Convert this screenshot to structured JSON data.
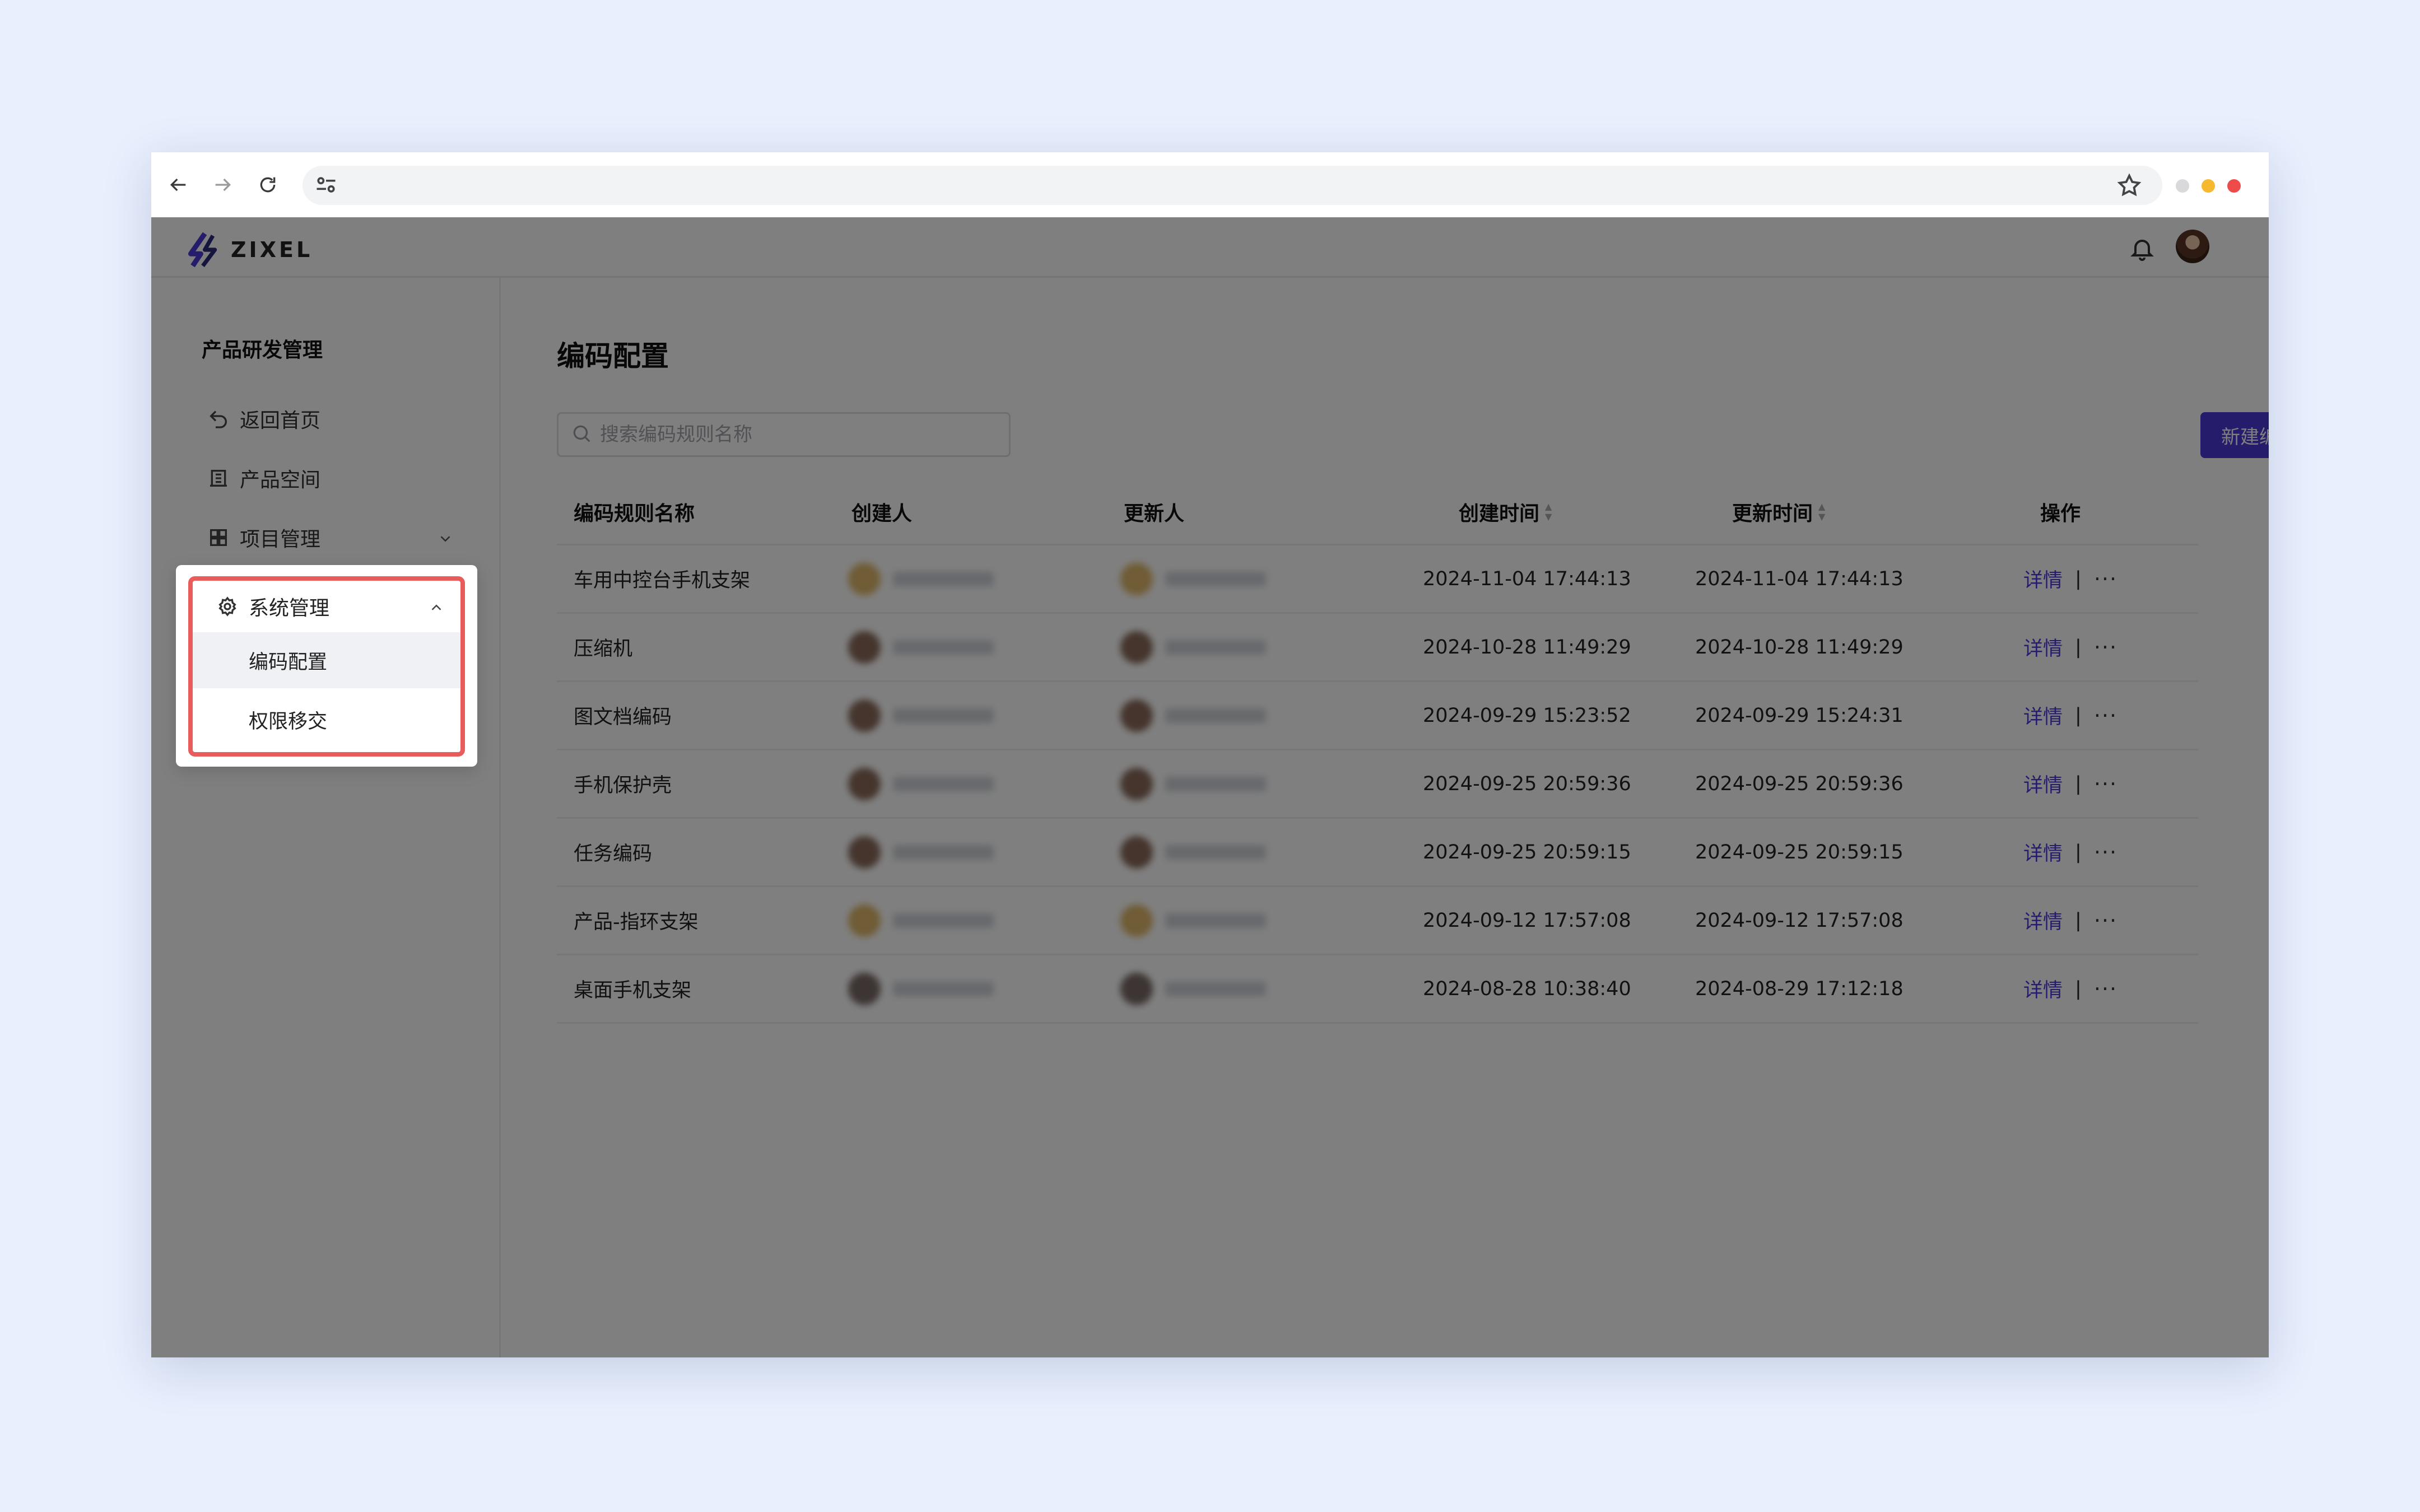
{
  "browser": {
    "url": ""
  },
  "app": {
    "brand": "ZIXEL"
  },
  "sidebar": {
    "title": "产品研发管理",
    "items": [
      {
        "label": "返回首页"
      },
      {
        "label": "产品空间"
      },
      {
        "label": "项目管理"
      },
      {
        "label": "系统管理"
      }
    ],
    "submenu": [
      {
        "label": "编码配置"
      },
      {
        "label": "权限移交"
      }
    ]
  },
  "main": {
    "title": "编码配置",
    "search_placeholder": "搜索编码规则名称",
    "new_button": "新建编码规则",
    "columns": [
      "编码规则名称",
      "创建人",
      "更新人",
      "创建时间",
      "更新时间",
      "操作"
    ],
    "rows": [
      {
        "name": "车用中控台手机支架",
        "created": "2024-11-04 17:44:13",
        "updated": "2024-11-04 17:44:13",
        "detail": "详情"
      },
      {
        "name": "压缩机",
        "created": "2024-10-28 11:49:29",
        "updated": "2024-10-28 11:49:29",
        "detail": "详情"
      },
      {
        "name": "图文档编码",
        "created": "2024-09-29 15:23:52",
        "updated": "2024-09-29 15:24:31",
        "detail": "详情"
      },
      {
        "name": "手机保护壳",
        "created": "2024-09-25 20:59:36",
        "updated": "2024-09-25 20:59:36",
        "detail": "详情"
      },
      {
        "name": "任务编码",
        "created": "2024-09-25 20:59:15",
        "updated": "2024-09-25 20:59:15",
        "detail": "详情"
      },
      {
        "name": "产品-指环支架",
        "created": "2024-09-12 17:57:08",
        "updated": "2024-09-12 17:57:08",
        "detail": "详情"
      },
      {
        "name": "桌面手机支架",
        "created": "2024-08-28 10:38:40",
        "updated": "2024-08-29 17:12:18",
        "detail": "详情"
      }
    ],
    "separator": "|",
    "more": "···"
  },
  "colors": {
    "accent": "#4b3bd6",
    "highlight_border": "#e85c5c",
    "background": "#e8effd"
  }
}
